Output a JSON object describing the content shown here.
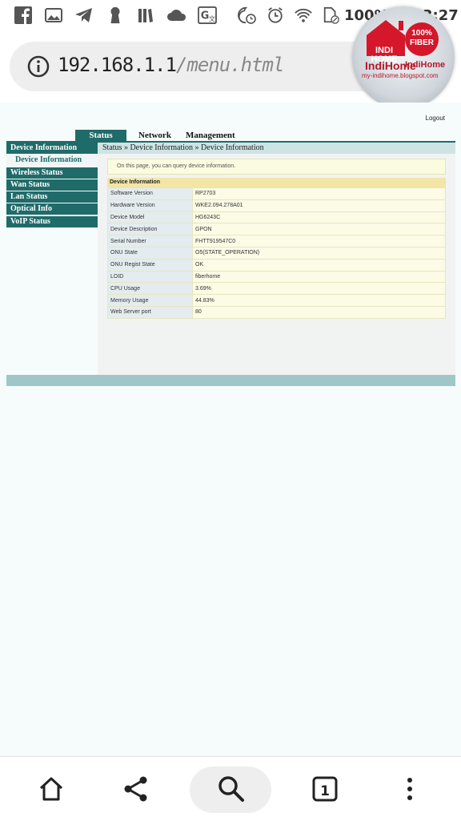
{
  "status_bar": {
    "battery": "100%",
    "time": "3:27",
    "icons": [
      "facebook-icon",
      "gallery-icon",
      "telegram-icon",
      "keyhole-icon",
      "books-icon",
      "cloud-icon",
      "translate-icon",
      "night-clock-icon",
      "alarm-icon",
      "wifi-icon",
      "sim-icon"
    ]
  },
  "browser": {
    "url_host": "192.168.1.1",
    "url_path": "/menu.html"
  },
  "watermark": {
    "house_text": "INDI HOME",
    "badge_text": "100% FIBER",
    "brand_large": "IndiHome",
    "brand_small": "IndiHome",
    "site": "my-indihome.blogspot.com"
  },
  "header": {
    "logout": "Logout",
    "tabs": [
      "Status",
      "Network",
      "Management"
    ]
  },
  "sidebar": {
    "items": [
      {
        "label": "Device Information"
      },
      {
        "label": "Device Information"
      },
      {
        "label": "Wireless Status"
      },
      {
        "label": "Wan Status"
      },
      {
        "label": "Lan Status"
      },
      {
        "label": "Optical Info"
      },
      {
        "label": "VoIP Status"
      }
    ]
  },
  "main": {
    "breadcrumb": "Status » Device Information » Device Information",
    "notice": "On this page, you can query device information.",
    "section_title": "Device Information",
    "rows": [
      {
        "key": "Software Version",
        "value": "RP2703"
      },
      {
        "key": "Hardware Version",
        "value": "WKE2.094.278A01"
      },
      {
        "key": "Device Model",
        "value": "HG6243C"
      },
      {
        "key": "Device Description",
        "value": "GPON"
      },
      {
        "key": "Serial Number",
        "value": "FHTT919547C0"
      },
      {
        "key": "ONU State",
        "value": "O5(STATE_OPERATION)"
      },
      {
        "key": "ONU Regist State",
        "value": "OK"
      },
      {
        "key": "LOID",
        "value": "fiberhome"
      },
      {
        "key": "CPU Usage",
        "value": "3.69%"
      },
      {
        "key": "Memory Usage",
        "value": "44.83%"
      },
      {
        "key": "Web Server port",
        "value": "80"
      }
    ]
  },
  "bottom_nav": {
    "tab_count": "1",
    "icons": [
      "home-icon",
      "share-icon",
      "search-icon",
      "tabs-icon",
      "more-icon"
    ]
  }
}
